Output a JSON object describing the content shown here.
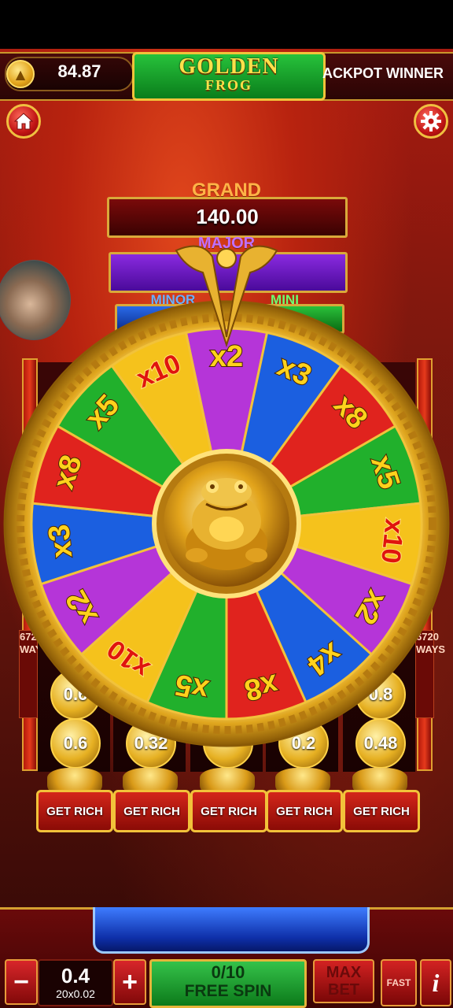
{
  "header": {
    "balance": "84.87",
    "logo_line1": "GOLDEN",
    "logo_line2": "FROG",
    "ticker": "ACKPOT WINNER"
  },
  "jackpots": {
    "grand_label": "GRAND",
    "grand_value": "140.00",
    "major_label": "MAJOR",
    "minor_label": "MINOR",
    "mini_label": "MINI"
  },
  "wheel": {
    "segments": [
      {
        "label": "x2",
        "color": "#b535d8"
      },
      {
        "label": "x3",
        "color": "#1b5fe0"
      },
      {
        "label": "x8",
        "color": "#e0231e"
      },
      {
        "label": "x5",
        "color": "#21b02c"
      },
      {
        "label": "x10",
        "color": "#f5c21c"
      },
      {
        "label": "x2",
        "color": "#b535d8"
      },
      {
        "label": "x4",
        "color": "#1b5fe0"
      },
      {
        "label": "x8",
        "color": "#e0231e"
      },
      {
        "label": "x5",
        "color": "#21b02c"
      },
      {
        "label": "x10",
        "color": "#f5c21c"
      },
      {
        "label": "x2",
        "color": "#b535d8"
      },
      {
        "label": "x3",
        "color": "#1b5fe0"
      },
      {
        "label": "x8",
        "color": "#e0231e"
      },
      {
        "label": "x5",
        "color": "#21b02c"
      },
      {
        "label": "x10",
        "color": "#f5c21c"
      }
    ]
  },
  "reels": {
    "ways_left": "6720 WAYS",
    "ways_right": "6720 WAYS",
    "top_balls": [
      "0.6",
      "",
      "",
      "",
      "0.8"
    ],
    "bottom_balls": [
      "0.6",
      "0.32",
      "",
      "0.2",
      "0.48"
    ],
    "get_rich_labels": [
      "GET RICH",
      "GET RICH",
      "GET RICH",
      "GET RICH",
      "GET RICH"
    ]
  },
  "controls": {
    "minus": "−",
    "plus": "+",
    "bet": "0.4",
    "bet_detail": "20x0.02",
    "free_spin_count": "0/10",
    "free_spin_label": "FREE SPIN",
    "max_bet_line1": "MAX",
    "max_bet_line2": "BET",
    "fast_label": "FAST",
    "info_label": "i"
  },
  "colors": {
    "gold": "#f0c040",
    "green": "#21b02c",
    "red": "#e0231e",
    "blue": "#1b5fe0",
    "purple": "#b535d8",
    "yellow": "#f5c21c"
  }
}
